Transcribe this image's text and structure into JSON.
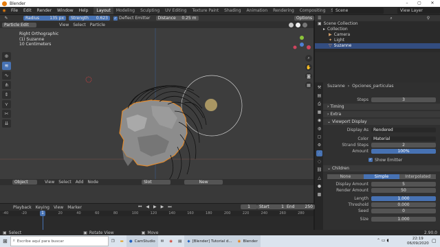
{
  "window": {
    "title": "Blender"
  },
  "menu": [
    "File",
    "Edit",
    "Render",
    "Window",
    "Help"
  ],
  "workspaces": [
    {
      "label": "Layout",
      "active": true
    },
    {
      "label": "Modeling"
    },
    {
      "label": "Sculpting"
    },
    {
      "label": "UV Editing"
    },
    {
      "label": "Texture Paint"
    },
    {
      "label": "Shading"
    },
    {
      "label": "Animation"
    },
    {
      "label": "Rendering"
    },
    {
      "label": "Compositing"
    },
    {
      "label": "Scripting"
    }
  ],
  "scene": {
    "label": "Scene",
    "view_layer": "View Layer"
  },
  "viewport": {
    "tool_settings": {
      "radius_label": "Radius",
      "radius_value": "135 px",
      "strength_label": "Strength",
      "strength_value": "0.623",
      "deflect_label": "Deflect Emitter",
      "distance_label": "Distance",
      "distance_value": "0.25 m"
    },
    "mode": "Particle Edit",
    "header_menus": [
      "View",
      "Select",
      "Particle"
    ],
    "options": "Options",
    "overlay_lines": [
      "Right Orthographic",
      "(1) Suzanne",
      "10 Centimeters"
    ]
  },
  "mid_header": {
    "mode": "Object",
    "menus": [
      "View",
      "Select",
      "Add",
      "Node"
    ],
    "slot": "Slot",
    "new_button": "New"
  },
  "timeline": {
    "menus": [
      "Playback",
      "Keying",
      "View",
      "Marker"
    ],
    "current_frame": "1",
    "start_label": "Start",
    "start": "1",
    "end_label": "End",
    "end": "250",
    "ticks": [
      "-40",
      "-20",
      "0",
      "20",
      "40",
      "60",
      "80",
      "100",
      "120",
      "140",
      "160",
      "180",
      "200",
      "220",
      "240",
      "260",
      "280"
    ]
  },
  "status": {
    "select": "Select",
    "rotate": "Rotate View",
    "move": "Move",
    "version": "2.90.0"
  },
  "outliner": {
    "title": "Scene Collection",
    "items": [
      {
        "label": "Collection",
        "indent": 1
      },
      {
        "label": "Camera",
        "indent": 2
      },
      {
        "label": "Light",
        "indent": 2
      },
      {
        "label": "Suzanne",
        "indent": 2,
        "selected": true
      }
    ]
  },
  "properties": {
    "object": "Suzanne",
    "particle_settings": "Opciones_particulas",
    "steps_label": "Steps",
    "steps_value": "3",
    "timing": "Timing",
    "extra": "Extra",
    "viewport_display": "Viewport Display",
    "display_as_label": "Display As",
    "display_as_value": "Rendered",
    "color_label": "Color",
    "color_value": "Material",
    "strand_steps_label": "Strand Steps",
    "strand_steps_value": "2",
    "amount_label": "Amount",
    "amount_value": "100%",
    "show_emitter": "Show Emitter",
    "children": "Children",
    "children_modes": [
      {
        "label": "None"
      },
      {
        "label": "Simple",
        "active": true
      },
      {
        "label": "Interpolated"
      }
    ],
    "display_amount_label": "Display Amount",
    "display_amount_value": "5",
    "render_amount_label": "Render Amount",
    "render_amount_value": "50",
    "length_label": "Length",
    "length_value": "1.000",
    "threshold_label": "Threshold",
    "threshold_value": "0.000",
    "seed_label": "Seed",
    "seed_value": "0",
    "size_label": "Size",
    "size_value": "1.000"
  },
  "taskbar": {
    "search_placeholder": "Escribe aquí para buscar",
    "apps": [
      "CamStudio",
      "[Blender] Tutorial d...",
      "Blender"
    ],
    "time": "22:19",
    "date": "06/09/2020"
  },
  "colors": {
    "accent": "#4772b3",
    "selection_orange": "#e08a2e",
    "viewport_bg": "#3d3d3d"
  }
}
